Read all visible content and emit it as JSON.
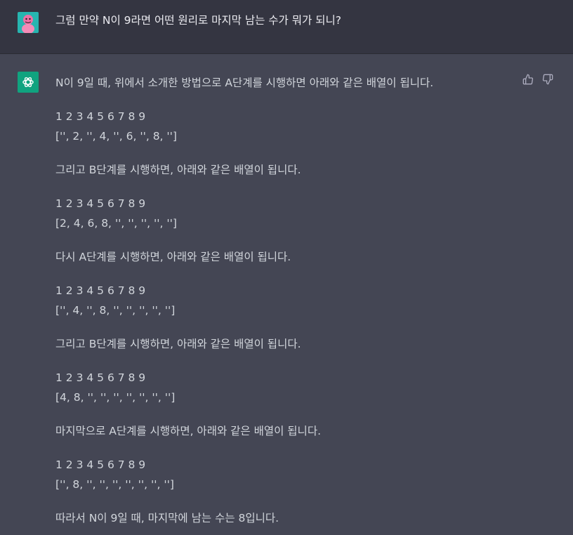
{
  "user": {
    "message": "그럼 만약 N이 9라면 어떤 원리로 마지막 남는 수가 뭐가 되니?"
  },
  "assistant": {
    "lines": [
      "N이 9일 때, 위에서 소개한 방법으로 A단계를 시행하면 아래와 같은 배열이 됩니다.",
      "1 2 3 4 5 6 7 8 9",
      "['', 2, '', 4, '', 6, '', 8, '']",
      "그리고 B단계를 시행하면, 아래와 같은 배열이 됩니다.",
      "1 2 3 4 5 6 7 8 9",
      "[2, 4, 6, 8, '', '', '', '', '']",
      "다시 A단계를 시행하면, 아래와 같은 배열이 됩니다.",
      "1 2 3 4 5 6 7 8 9",
      "['', 4, '', 8, '', '', '', '', '']",
      "그리고 B단계를 시행하면, 아래와 같은 배열이 됩니다.",
      "1 2 3 4 5 6 7 8 9",
      "[4, 8, '', '', '', '', '', '', '']",
      "마지막으로 A단계를 시행하면, 아래와 같은 배열이 됩니다.",
      "1 2 3 4 5 6 7 8 9",
      "['', 8, '', '', '', '', '', '', '']",
      "따라서 N이 9일 때, 마지막에 남는 수는 8입니다."
    ],
    "actions": {
      "thumbs_up_icon": "thumbs-up-icon",
      "thumbs_down_icon": "thumbs-down-icon"
    }
  },
  "colors": {
    "user_bg": "#343541",
    "assistant_bg": "#444654",
    "accent": "#10a37f",
    "text": "#d1d5db"
  }
}
